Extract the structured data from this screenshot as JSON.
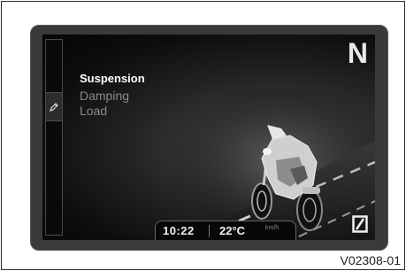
{
  "display": {
    "menu": {
      "title": "Suspension",
      "items": [
        {
          "label": "Damping"
        },
        {
          "label": "Load"
        }
      ]
    },
    "gear": "N",
    "status": {
      "time": "10:22",
      "temperature": "22°C",
      "speed_unit": "km/h"
    },
    "icons": {
      "side_icon": "pencil-icon",
      "corner_icon": "zero-box-icon",
      "illustration": "motorcycle-on-road"
    }
  },
  "figure": {
    "reference": "V02308-01"
  }
}
